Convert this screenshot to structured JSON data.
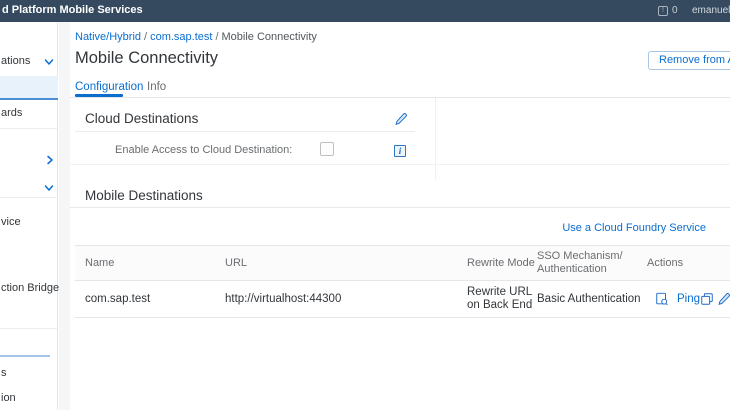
{
  "topbar": {
    "title": "d Platform Mobile Services",
    "notification_glyph": "!",
    "notification_count": "0",
    "user": "emanuel.a"
  },
  "sidebar": {
    "items": [
      {
        "label": "ations"
      },
      {
        "label": ""
      },
      {
        "label": "ards"
      },
      {
        "label": ""
      },
      {
        "label": ""
      },
      {
        "label": "vice"
      },
      {
        "label": "ction Bridge"
      },
      {
        "label": "s"
      },
      {
        "label": "ion"
      }
    ]
  },
  "breadcrumb": {
    "link1": "Native/Hybrid",
    "sep1": "/",
    "link2": "com.sap.test",
    "sep2": "/",
    "current": "Mobile Connectivity"
  },
  "page": {
    "title": "Mobile Connectivity",
    "remove_button_label": "Remove from Appl"
  },
  "tabs": {
    "configuration": "Configuration",
    "info": "Info"
  },
  "cloud_destinations": {
    "title": "Cloud Destinations",
    "enable_label": "Enable Access to Cloud Destination:",
    "checkbox_checked": false,
    "info_glyph": "i"
  },
  "mobile_destinations": {
    "title": "Mobile Destinations",
    "toolbar_link": "Use a Cloud Foundry Service",
    "table": {
      "columns": {
        "name": "Name",
        "url": "URL",
        "rewrite": "Rewrite Mode",
        "sso": "SSO Mechanism/\nAuthentication",
        "actions": "Actions"
      },
      "row": {
        "name": "com.sap.test",
        "url": "http://virtualhost:44300",
        "rewrite": "Rewrite URL on Back End",
        "sso": "Basic Authentication",
        "ping_label": "Ping"
      }
    }
  },
  "icons": [
    "notification-icon",
    "chevron-down-icon",
    "chevron-right-icon",
    "edit-pencil-icon",
    "info-icon",
    "inspect-icon",
    "copy-icon",
    "edit-icon",
    "delete-icon"
  ],
  "colors": {
    "topbar": "#354a5f",
    "accent": "#0a6ed1",
    "selected_item_bg": "#e8f2fb",
    "text_dark": "#32363a",
    "text_gray": "#6a6d70"
  }
}
